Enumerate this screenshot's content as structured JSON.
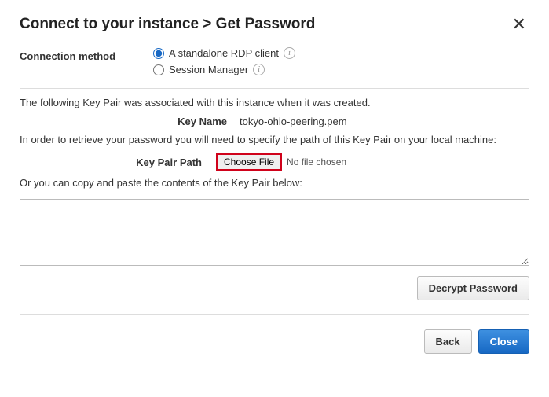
{
  "header": {
    "title": "Connect to your instance > Get Password"
  },
  "connection": {
    "label": "Connection method",
    "options": {
      "rdp": "A standalone RDP client",
      "ssm": "Session Manager"
    }
  },
  "body": {
    "intro": "The following Key Pair was associated with this instance when it was created.",
    "keyNameLabel": "Key Name",
    "keyNameValue": "tokyo-ohio-peering.pem",
    "retrieveText": "In order to retrieve your password you will need to specify the path of this Key Pair on your local machine:",
    "keyPairPathLabel": "Key Pair Path",
    "chooseFile": "Choose File",
    "noFileChosen": "No file chosen",
    "pasteText": "Or you can copy and paste the contents of the Key Pair below:"
  },
  "buttons": {
    "decrypt": "Decrypt Password",
    "back": "Back",
    "close": "Close"
  }
}
